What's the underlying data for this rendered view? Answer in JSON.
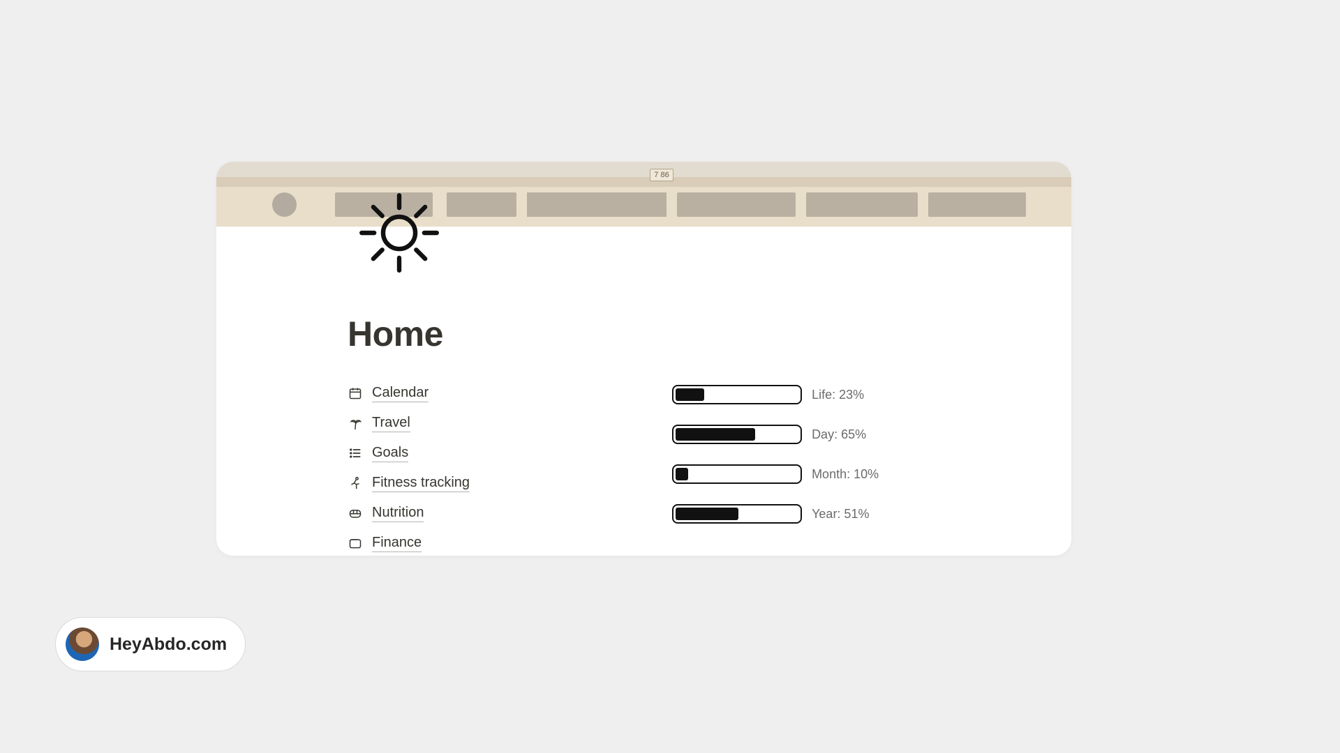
{
  "page": {
    "title": "Home",
    "icon": "sun-icon"
  },
  "cover": {
    "plate": "7 86"
  },
  "nav": {
    "items": [
      {
        "label": "Calendar",
        "icon": "calendar-icon"
      },
      {
        "label": "Travel",
        "icon": "palm-tree-icon"
      },
      {
        "label": "Goals",
        "icon": "list-icon"
      },
      {
        "label": "Fitness tracking",
        "icon": "fitness-icon"
      },
      {
        "label": "Nutrition",
        "icon": "bento-icon"
      },
      {
        "label": "Finance",
        "icon": "wallet-icon"
      }
    ]
  },
  "progress": {
    "items": [
      {
        "label": "Life",
        "value": 23
      },
      {
        "label": "Day",
        "value": 65
      },
      {
        "label": "Month",
        "value": 10
      },
      {
        "label": "Year",
        "value": 51
      }
    ]
  },
  "attribution": {
    "label": "HeyAbdo.com"
  }
}
